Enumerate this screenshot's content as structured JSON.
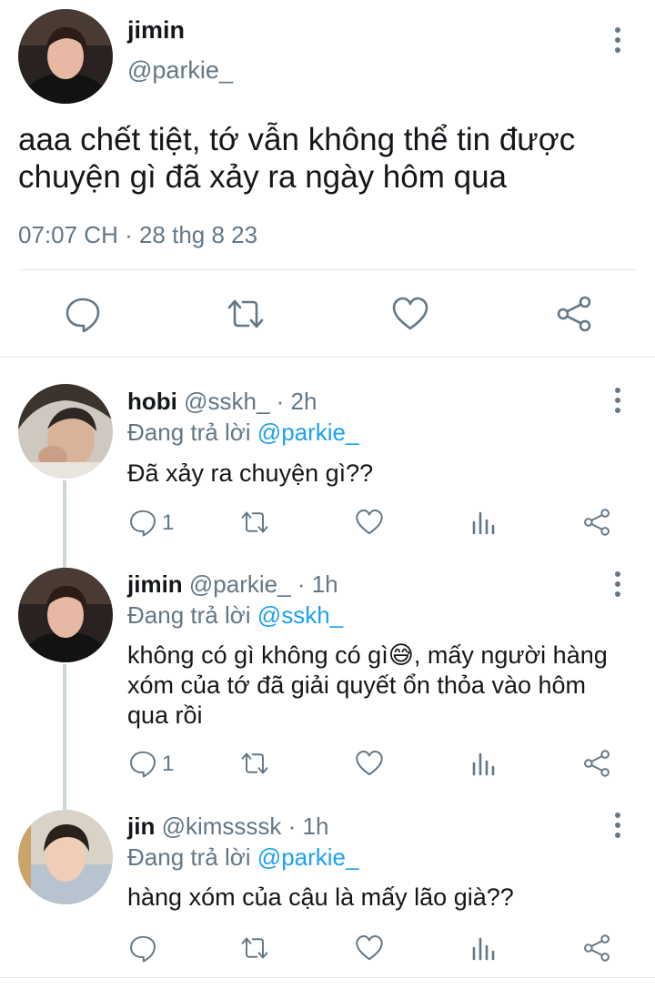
{
  "main_tweet": {
    "author_name": "jimin",
    "author_handle": "@parkie_",
    "text_line1": "aaa chết tiệt, tớ vẫn không thể tin được",
    "text_line2": "chuyện gì đã xảy ra ngày hôm qua",
    "timestamp": "07:07 CH · 28 thg 8 23",
    "actions": [
      "reply-icon",
      "retweet-icon",
      "like-icon",
      "share-icon"
    ]
  },
  "replies": [
    {
      "name": "hobi",
      "handle": "@sskh_",
      "time": "· 2h",
      "replying_prefix": "Đang trả lời",
      "replying_to": "@parkie_",
      "text_lines": [
        "Đã xảy ra chuyện gì??"
      ],
      "reply_count": "1"
    },
    {
      "name": "jimin",
      "handle": "@parkie_",
      "time": "· 1h",
      "replying_prefix": "Đang trả lời",
      "replying_to": "@sskh_",
      "text_lines": [
        "không có gì không có gì😅, mấy người hàng",
        "xóm của tớ đã giải quyết ổn thỏa vào hôm",
        "qua rồi"
      ],
      "reply_count": "1"
    },
    {
      "name": "jin",
      "handle": "@kimssssk",
      "time": "· 1h",
      "replying_prefix": "Đang trả lời",
      "replying_to": "@parkie_",
      "text_lines": [
        "hàng xóm của cậu là mấy lão già??"
      ],
      "reply_count": ""
    }
  ],
  "colors": {
    "accent": "#1da1f2",
    "secondary_text": "#657786",
    "divider": "#e1e8ed",
    "thread_line": "#ccd6dd"
  }
}
